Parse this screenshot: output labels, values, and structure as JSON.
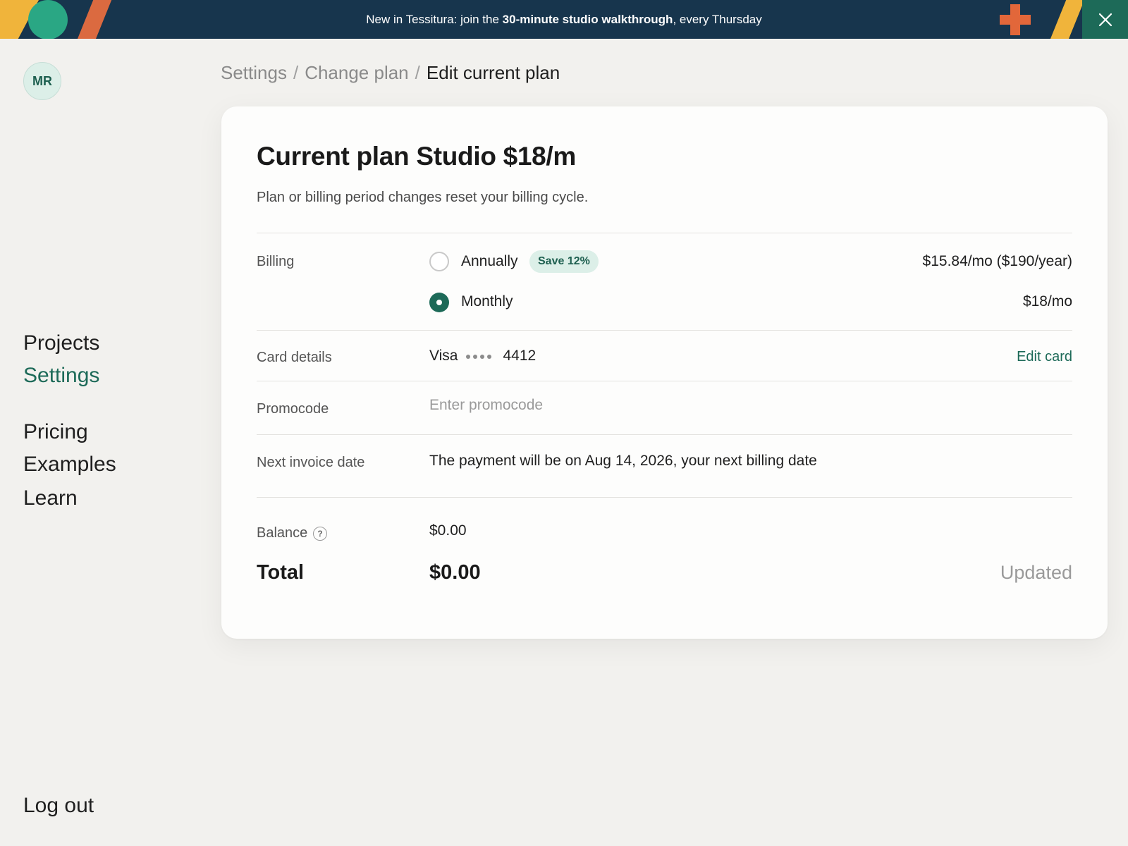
{
  "banner": {
    "text_prefix": "New in Tessitura: join the ",
    "text_bold": "30-minute studio walkthrough",
    "text_suffix": ", every Thursday",
    "colors": {
      "background": "#17354d",
      "close_background": "#1d6a58",
      "accent_yellow": "#f0b43b",
      "accent_orange": "#db6a40",
      "accent_green": "#2aa784"
    }
  },
  "user": {
    "initials": "MR"
  },
  "sidebar": {
    "primary": [
      "Projects",
      "Settings"
    ],
    "secondary": [
      "Pricing",
      "Examples",
      "Learn"
    ],
    "active": "Settings",
    "logout": "Log out"
  },
  "breadcrumb": {
    "items": [
      "Settings",
      "Change plan"
    ],
    "separator": "/",
    "current": "Edit current plan"
  },
  "plan": {
    "title": "Current plan Studio $18/m",
    "subtitle": "Plan or billing period changes reset your billing cycle.",
    "billing": {
      "label": "Billing",
      "options": [
        {
          "label": "Annually",
          "badge": "Save 12%",
          "price": "$15.84/mo ($190/year)",
          "selected": false
        },
        {
          "label": "Monthly",
          "price": "$18/mo",
          "selected": true
        }
      ]
    },
    "card": {
      "label": "Card details",
      "brand": "Visa",
      "last4": "4412",
      "edit_label": "Edit card"
    },
    "promo": {
      "label": "Promocode",
      "placeholder": "Enter promocode",
      "value": ""
    },
    "invoice": {
      "label": "Next invoice date",
      "text": "The payment will be on Aug 14, 2026, your next billing date"
    },
    "balance": {
      "label": "Balance",
      "help_icon": "?",
      "value": "$0.00"
    },
    "total": {
      "label": "Total",
      "value": "$0.00",
      "status": "Updated"
    }
  },
  "accent_color": "#1d6a58"
}
